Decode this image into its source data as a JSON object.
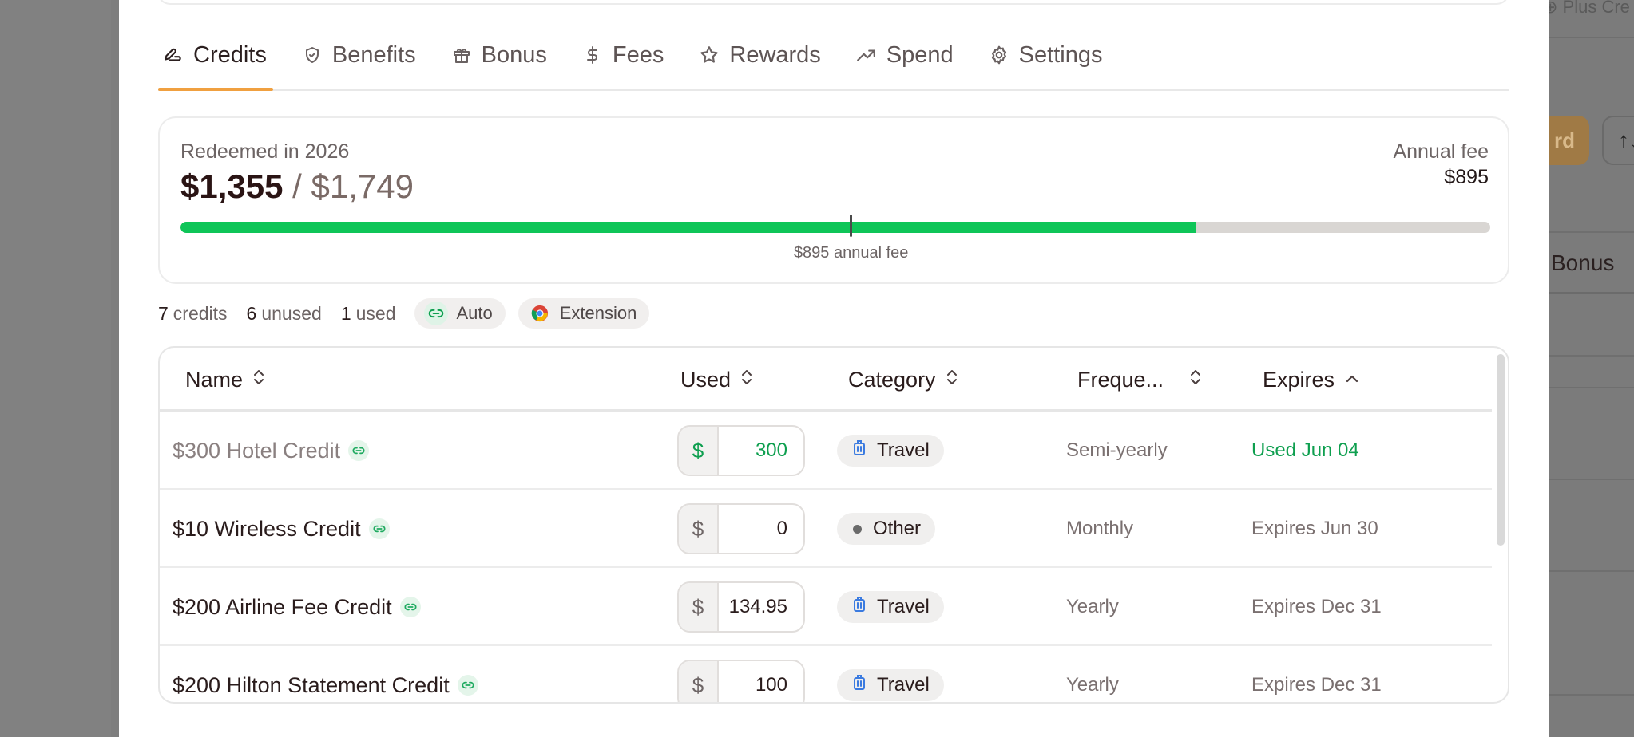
{
  "background": {
    "top_right_text": "⊕ Plus Cre",
    "orange_button_text": "rd",
    "gray_button_text": "↑↓",
    "tab_text": "Bonus"
  },
  "tabs": [
    {
      "label": "Credits",
      "icon": "credits-icon",
      "active": true
    },
    {
      "label": "Benefits",
      "icon": "shield-icon"
    },
    {
      "label": "Bonus",
      "icon": "gift-icon"
    },
    {
      "label": "Fees",
      "icon": "dollar-icon"
    },
    {
      "label": "Rewards",
      "icon": "star-icon"
    },
    {
      "label": "Spend",
      "icon": "trend-icon"
    },
    {
      "label": "Settings",
      "icon": "gear-icon"
    }
  ],
  "summary": {
    "label": "Redeemed in 2026",
    "redeemed": "$1,355",
    "separator": "/",
    "total": "$1,749",
    "annual_fee_label": "Annual fee",
    "annual_fee_value": "$895",
    "progress_fraction": 0.775,
    "fee_marker_fraction": 0.512,
    "marker_caption": "$895 annual fee",
    "bar_color": "#0ec558"
  },
  "stats": {
    "credits_count": "7",
    "credits_label": "credits",
    "unused_count": "6",
    "unused_label": "unused",
    "used_count": "1",
    "used_label": "used",
    "auto_label": "Auto",
    "extension_label": "Extension"
  },
  "table": {
    "columns": [
      "Name",
      "Used",
      "Category",
      "Freque...",
      "Expires"
    ],
    "rows": [
      {
        "name": "$300 Hotel Credit",
        "currency": "$",
        "used": "300",
        "category": "Travel",
        "cat_icon": "luggage-icon",
        "frequency": "Semi-yearly",
        "expires": "Used Jun 04",
        "status": "used"
      },
      {
        "name": "$10 Wireless Credit",
        "currency": "$",
        "used": "0",
        "category": "Other",
        "cat_icon": "dot-icon",
        "frequency": "Monthly",
        "expires": "Expires Jun 30",
        "status": "open"
      },
      {
        "name": "$200 Airline Fee Credit",
        "currency": "$",
        "used": "134.95",
        "category": "Travel",
        "cat_icon": "luggage-icon",
        "frequency": "Yearly",
        "expires": "Expires Dec 31",
        "status": "open"
      },
      {
        "name": "$200 Hilton Statement Credit",
        "currency": "$",
        "used": "100",
        "category": "Travel",
        "cat_icon": "luggage-icon",
        "frequency": "Yearly",
        "expires": "Expires Dec 31",
        "status": "open"
      }
    ]
  },
  "colors": {
    "accent": "#f0a040",
    "green": "#0e9f4f",
    "travel_icon": "#3b7be0"
  }
}
